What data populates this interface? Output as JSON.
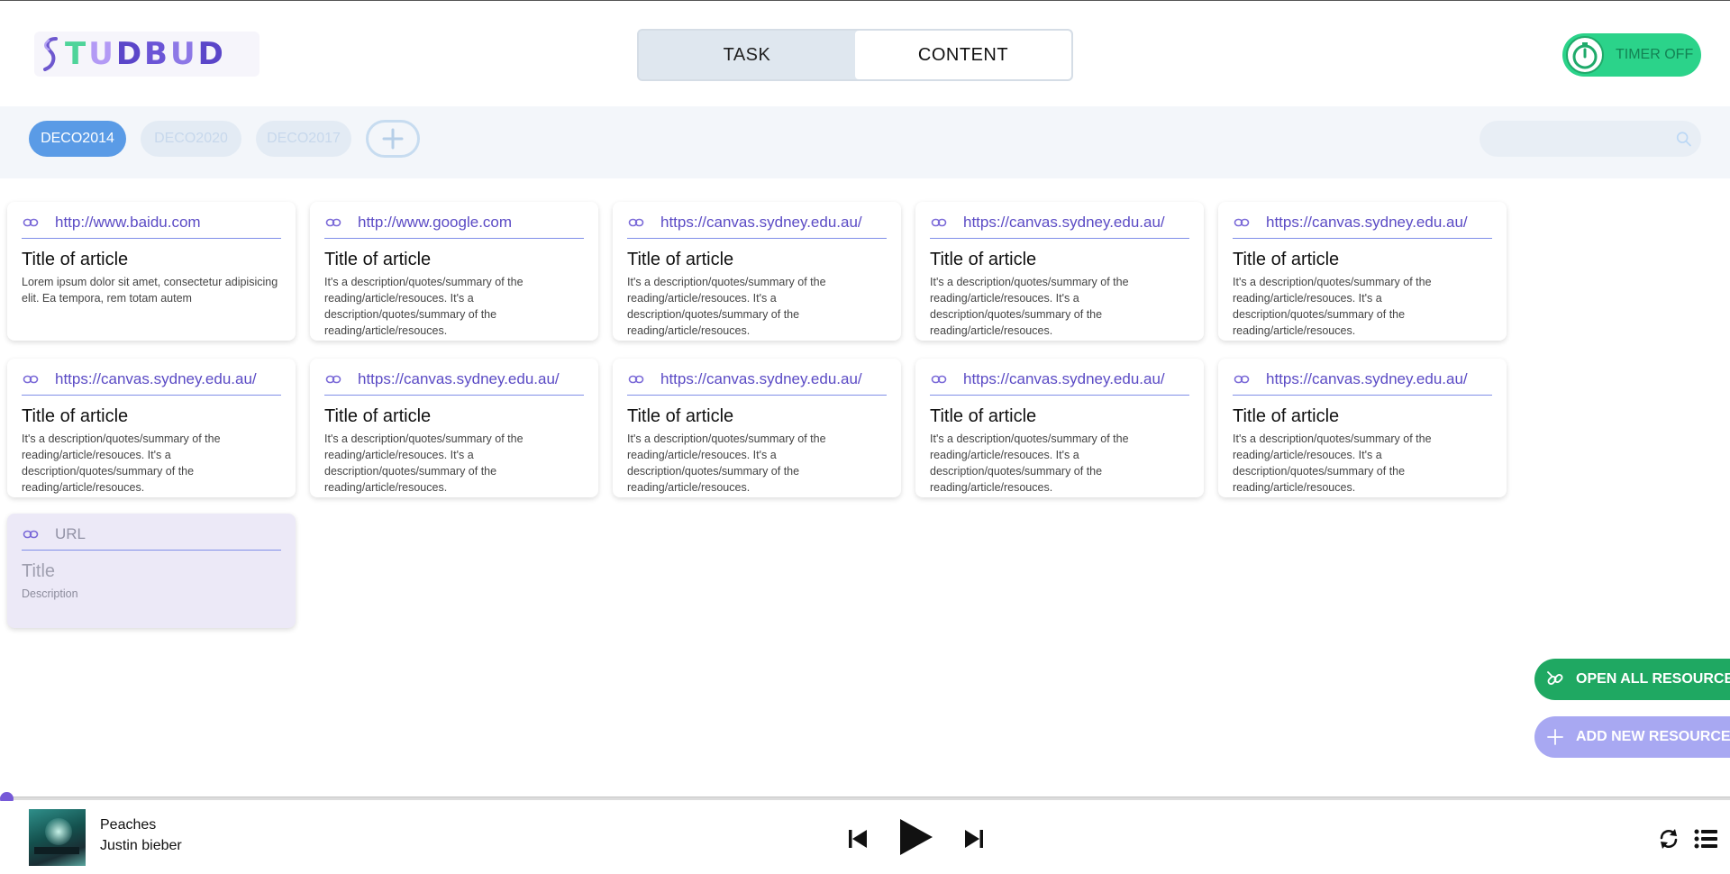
{
  "app": {
    "logo_text": "STUDBUD",
    "logo_letters": [
      {
        "ch": "T",
        "color": "#4fd49a"
      },
      {
        "ch": "U",
        "color": "#b39af5"
      },
      {
        "ch": "D",
        "color": "#5b46c9"
      },
      {
        "ch": "B",
        "color": "#6b55d6"
      },
      {
        "ch": "U",
        "color": "#8d78e6"
      },
      {
        "ch": "D",
        "color": "#5b46c9"
      }
    ]
  },
  "header": {
    "tabs": [
      {
        "label": "TASK",
        "active": false
      },
      {
        "label": "CONTENT",
        "active": true
      }
    ],
    "timer": {
      "label": "TIMER OFF",
      "state": "off",
      "color": "#2bd38a"
    }
  },
  "courses": {
    "items": [
      {
        "code": "DECO2014",
        "active": true
      },
      {
        "code": "DECO2020",
        "active": false
      },
      {
        "code": "DECO2017",
        "active": false
      }
    ],
    "add_icon": "plus-icon",
    "search": {
      "placeholder": "",
      "value": "",
      "icon": "search-icon"
    }
  },
  "resources": {
    "cards": [
      {
        "url": "http://www.baidu.com",
        "title": "Title of article",
        "description": "Lorem ipsum dolor sit amet, consectetur adipisicing elit. Ea tempora, rem totam autem"
      },
      {
        "url": "http://www.google.com",
        "title": "Title of article",
        "description": "It's a description/quotes/summary of the reading/article/resouces. It's a description/quotes/summary of the reading/article/resouces."
      },
      {
        "url": "https://canvas.sydney.edu.au/",
        "title": "Title of article",
        "description": "It's a description/quotes/summary of the reading/article/resouces. It's a description/quotes/summary of the reading/article/resouces."
      },
      {
        "url": "https://canvas.sydney.edu.au/",
        "title": "Title of article",
        "description": "It's a description/quotes/summary of the reading/article/resouces. It's a description/quotes/summary of the reading/article/resouces."
      },
      {
        "url": "https://canvas.sydney.edu.au/",
        "title": "Title of article",
        "description": "It's a description/quotes/summary of the reading/article/resouces. It's a description/quotes/summary of the reading/article/resouces."
      },
      {
        "url": "https://canvas.sydney.edu.au/",
        "title": "Title of article",
        "description": "It's a description/quotes/summary of the reading/article/resouces. It's a description/quotes/summary of the reading/article/resouces."
      },
      {
        "url": "https://canvas.sydney.edu.au/",
        "title": "Title of article",
        "description": "It's a description/quotes/summary of the reading/article/resouces. It's a description/quotes/summary of the reading/article/resouces."
      },
      {
        "url": "https://canvas.sydney.edu.au/",
        "title": "Title of article",
        "description": "It's a description/quotes/summary of the reading/article/resouces. It's a description/quotes/summary of the reading/article/resouces."
      },
      {
        "url": "https://canvas.sydney.edu.au/",
        "title": "Title of article",
        "description": "It's a description/quotes/summary of the reading/article/resouces. It's a description/quotes/summary of the reading/article/resouces."
      },
      {
        "url": "https://canvas.sydney.edu.au/",
        "title": "Title of article",
        "description": "It's a description/quotes/summary of the reading/article/resouces. It's a description/quotes/summary of the reading/article/resouces."
      }
    ],
    "new_card": {
      "url_placeholder": "URL",
      "title_placeholder": "Title",
      "description_placeholder": "Description"
    }
  },
  "actions": {
    "open_all": {
      "label": "OPEN ALL RESOURCE",
      "icon": "link-off-icon",
      "color": "#1fa862"
    },
    "add_new": {
      "label": "ADD NEW RESOURCE",
      "icon": "plus-icon",
      "color": "#a8a8f2"
    }
  },
  "player": {
    "track_title": "Peaches",
    "artist": "Justin bieber",
    "progress": 0.0,
    "controls": [
      "skip-previous-icon",
      "play-icon",
      "skip-next-icon"
    ],
    "extras": [
      "repeat-icon",
      "playlist-icon"
    ],
    "accent": "#7659d8"
  }
}
